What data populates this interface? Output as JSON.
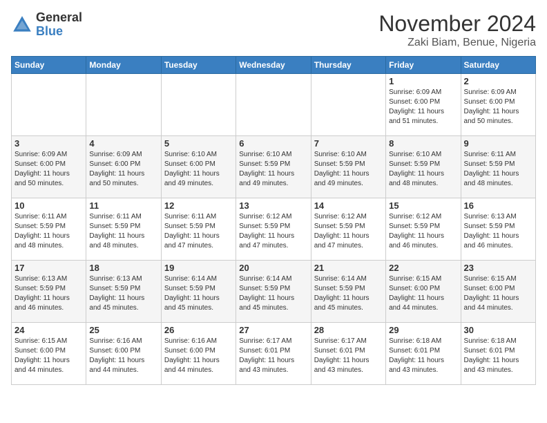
{
  "header": {
    "logo_general": "General",
    "logo_blue": "Blue",
    "month_title": "November 2024",
    "location": "Zaki Biam, Benue, Nigeria"
  },
  "weekdays": [
    "Sunday",
    "Monday",
    "Tuesday",
    "Wednesday",
    "Thursday",
    "Friday",
    "Saturday"
  ],
  "weeks": [
    [
      {
        "day": "",
        "info": ""
      },
      {
        "day": "",
        "info": ""
      },
      {
        "day": "",
        "info": ""
      },
      {
        "day": "",
        "info": ""
      },
      {
        "day": "",
        "info": ""
      },
      {
        "day": "1",
        "info": "Sunrise: 6:09 AM\nSunset: 6:00 PM\nDaylight: 11 hours\nand 51 minutes."
      },
      {
        "day": "2",
        "info": "Sunrise: 6:09 AM\nSunset: 6:00 PM\nDaylight: 11 hours\nand 50 minutes."
      }
    ],
    [
      {
        "day": "3",
        "info": "Sunrise: 6:09 AM\nSunset: 6:00 PM\nDaylight: 11 hours\nand 50 minutes."
      },
      {
        "day": "4",
        "info": "Sunrise: 6:09 AM\nSunset: 6:00 PM\nDaylight: 11 hours\nand 50 minutes."
      },
      {
        "day": "5",
        "info": "Sunrise: 6:10 AM\nSunset: 6:00 PM\nDaylight: 11 hours\nand 49 minutes."
      },
      {
        "day": "6",
        "info": "Sunrise: 6:10 AM\nSunset: 5:59 PM\nDaylight: 11 hours\nand 49 minutes."
      },
      {
        "day": "7",
        "info": "Sunrise: 6:10 AM\nSunset: 5:59 PM\nDaylight: 11 hours\nand 49 minutes."
      },
      {
        "day": "8",
        "info": "Sunrise: 6:10 AM\nSunset: 5:59 PM\nDaylight: 11 hours\nand 48 minutes."
      },
      {
        "day": "9",
        "info": "Sunrise: 6:11 AM\nSunset: 5:59 PM\nDaylight: 11 hours\nand 48 minutes."
      }
    ],
    [
      {
        "day": "10",
        "info": "Sunrise: 6:11 AM\nSunset: 5:59 PM\nDaylight: 11 hours\nand 48 minutes."
      },
      {
        "day": "11",
        "info": "Sunrise: 6:11 AM\nSunset: 5:59 PM\nDaylight: 11 hours\nand 48 minutes."
      },
      {
        "day": "12",
        "info": "Sunrise: 6:11 AM\nSunset: 5:59 PM\nDaylight: 11 hours\nand 47 minutes."
      },
      {
        "day": "13",
        "info": "Sunrise: 6:12 AM\nSunset: 5:59 PM\nDaylight: 11 hours\nand 47 minutes."
      },
      {
        "day": "14",
        "info": "Sunrise: 6:12 AM\nSunset: 5:59 PM\nDaylight: 11 hours\nand 47 minutes."
      },
      {
        "day": "15",
        "info": "Sunrise: 6:12 AM\nSunset: 5:59 PM\nDaylight: 11 hours\nand 46 minutes."
      },
      {
        "day": "16",
        "info": "Sunrise: 6:13 AM\nSunset: 5:59 PM\nDaylight: 11 hours\nand 46 minutes."
      }
    ],
    [
      {
        "day": "17",
        "info": "Sunrise: 6:13 AM\nSunset: 5:59 PM\nDaylight: 11 hours\nand 46 minutes."
      },
      {
        "day": "18",
        "info": "Sunrise: 6:13 AM\nSunset: 5:59 PM\nDaylight: 11 hours\nand 45 minutes."
      },
      {
        "day": "19",
        "info": "Sunrise: 6:14 AM\nSunset: 5:59 PM\nDaylight: 11 hours\nand 45 minutes."
      },
      {
        "day": "20",
        "info": "Sunrise: 6:14 AM\nSunset: 5:59 PM\nDaylight: 11 hours\nand 45 minutes."
      },
      {
        "day": "21",
        "info": "Sunrise: 6:14 AM\nSunset: 5:59 PM\nDaylight: 11 hours\nand 45 minutes."
      },
      {
        "day": "22",
        "info": "Sunrise: 6:15 AM\nSunset: 6:00 PM\nDaylight: 11 hours\nand 44 minutes."
      },
      {
        "day": "23",
        "info": "Sunrise: 6:15 AM\nSunset: 6:00 PM\nDaylight: 11 hours\nand 44 minutes."
      }
    ],
    [
      {
        "day": "24",
        "info": "Sunrise: 6:15 AM\nSunset: 6:00 PM\nDaylight: 11 hours\nand 44 minutes."
      },
      {
        "day": "25",
        "info": "Sunrise: 6:16 AM\nSunset: 6:00 PM\nDaylight: 11 hours\nand 44 minutes."
      },
      {
        "day": "26",
        "info": "Sunrise: 6:16 AM\nSunset: 6:00 PM\nDaylight: 11 hours\nand 44 minutes."
      },
      {
        "day": "27",
        "info": "Sunrise: 6:17 AM\nSunset: 6:01 PM\nDaylight: 11 hours\nand 43 minutes."
      },
      {
        "day": "28",
        "info": "Sunrise: 6:17 AM\nSunset: 6:01 PM\nDaylight: 11 hours\nand 43 minutes."
      },
      {
        "day": "29",
        "info": "Sunrise: 6:18 AM\nSunset: 6:01 PM\nDaylight: 11 hours\nand 43 minutes."
      },
      {
        "day": "30",
        "info": "Sunrise: 6:18 AM\nSunset: 6:01 PM\nDaylight: 11 hours\nand 43 minutes."
      }
    ]
  ]
}
